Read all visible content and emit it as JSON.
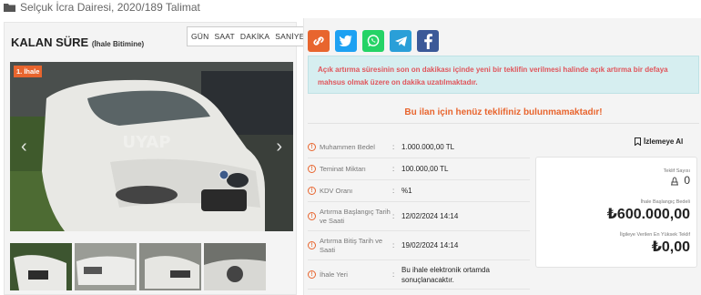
{
  "header": {
    "title": "Selçuk İcra Dairesi, 2020/189 Talimat",
    "icon": "folder-icon"
  },
  "countdown": {
    "title": "KALAN SÜRE",
    "subtitle": "(İhale Bitimine)",
    "units": [
      "GÜN",
      "SAAT",
      "DAKİKA",
      "SANİYE"
    ]
  },
  "gallery": {
    "badge": "1. İhale",
    "watermark": "UYAP",
    "thumb_count": 4
  },
  "share": {
    "buttons": [
      {
        "name": "link-icon",
        "color": "#e8652e"
      },
      {
        "name": "twitter-icon",
        "color": "#1da1f2"
      },
      {
        "name": "whatsapp-icon",
        "color": "#25d366"
      },
      {
        "name": "telegram-icon",
        "color": "#2a9fd8"
      },
      {
        "name": "facebook-icon",
        "color": "#3b5998"
      }
    ]
  },
  "notice": "Açık artırma süresinin son on dakikası içinde yeni bir teklifin verilmesi halinde açık artırma bir defaya mahsus olmak üzere on dakika uzatılmaktadır.",
  "no_bid_message": "Bu ilan için henüz teklifiniz bulunmamaktadır!",
  "details": [
    {
      "label": "Muhammen Bedel",
      "value": "1.000.000,00 TL"
    },
    {
      "label": "Teminat Miktarı",
      "value": "100.000,00 TL"
    },
    {
      "label": "KDV Oranı",
      "value": "%1"
    },
    {
      "label": "Artırma Başlangıç Tarih ve Saati",
      "value": "12/02/2024 14:14"
    },
    {
      "label": "Artırma Bitiş Tarih ve Saati",
      "value": "19/02/2024 14:14"
    },
    {
      "label": "İhale Yeri",
      "value": "Bu ihale elektronik ortamda sonuçlanacaktır."
    }
  ],
  "watch_label": "İzlemeye Al",
  "bid_summary": {
    "offer_count_label": "Teklif Sayısı",
    "offer_count": "0",
    "start_price_label": "İhale Başlangıç Bedeli",
    "start_price": "₺600.000,00",
    "highest_bid_label": "İlgileye Verilen En Yüksek Teklif",
    "highest_bid": "₺0,00"
  },
  "colors": {
    "accent": "#e8652e",
    "notice_bg": "#d6eef0",
    "notice_text": "#e0555b"
  }
}
